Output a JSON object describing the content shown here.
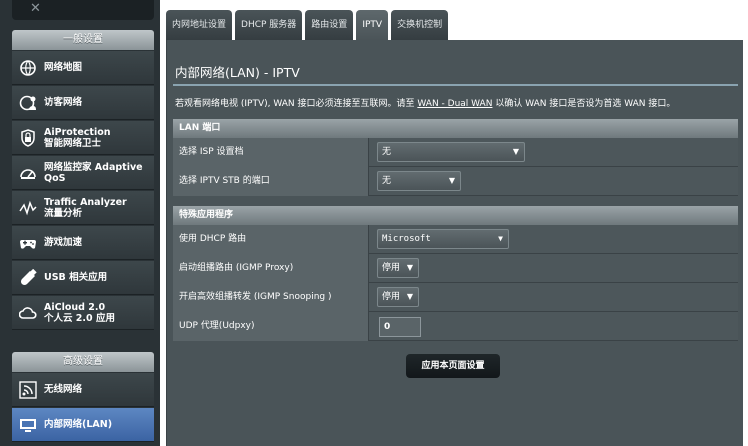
{
  "sidebar": {
    "general_section": "一般设置",
    "general_items": [
      {
        "icon": "globe-map-icon",
        "label": "网络地图",
        "sub": ""
      },
      {
        "icon": "guest-network-icon",
        "label": "访客网络",
        "sub": ""
      },
      {
        "icon": "lock-shield-icon",
        "label": "AiProtection",
        "sub": "智能网络卫士"
      },
      {
        "icon": "speedometer-icon",
        "label": "网络监控家 Adaptive",
        "sub": "QoS"
      },
      {
        "icon": "traffic-chart-icon",
        "label": "Traffic Analyzer",
        "sub": "流量分析"
      },
      {
        "icon": "gamepad-icon",
        "label": "游戏加速",
        "sub": ""
      },
      {
        "icon": "usb-icon",
        "label": "USB 相关应用",
        "sub": ""
      },
      {
        "icon": "cloud-icon",
        "label": "AiCloud 2.0",
        "sub": "个人云 2.0 应用"
      }
    ],
    "advanced_section": "高级设置",
    "advanced_items": [
      {
        "icon": "wireless-icon",
        "label": "无线网络"
      },
      {
        "icon": "lan-monitor-icon",
        "label": "内部网络(LAN)"
      }
    ]
  },
  "tabs": [
    "内网地址设置",
    "DHCP 服务器",
    "路由设置",
    "IPTV",
    "交换机控制"
  ],
  "active_tab": "IPTV",
  "page": {
    "title": "内部网络(LAN) - IPTV",
    "intro_before": "若观看网络电视 (IPTV), WAN 接口必须连接至互联网。请至",
    "intro_link": "WAN - Dual WAN",
    "intro_after": "以确认 WAN 接口是否设为首选 WAN 接口。"
  },
  "lan_port": {
    "header": "LAN 端口",
    "isp_label": "选择 ISP 设置档",
    "isp_value": "无",
    "stb_label": "选择 IPTV STB 的端口",
    "stb_value": "无"
  },
  "special_apps": {
    "header": "特殊应用程序",
    "dhcp_route_label": "使用 DHCP 路由",
    "dhcp_route_value": "Microsoft",
    "igmp_proxy_label": "启动组播路由 (IGMP Proxy)",
    "igmp_proxy_value": "停用",
    "igmp_snooping_label": "开启高效组播转发 (IGMP Snooping )",
    "igmp_snooping_value": "停用",
    "udpxy_label": "UDP 代理(Udpxy)",
    "udpxy_value": "0"
  },
  "apply_button": "应用本页面设置",
  "colors": {
    "sidebar_bg": "#2a3236",
    "panel_bg": "#4a5458",
    "active_item": "#4a74b4",
    "rule": "#8aa3b0"
  }
}
